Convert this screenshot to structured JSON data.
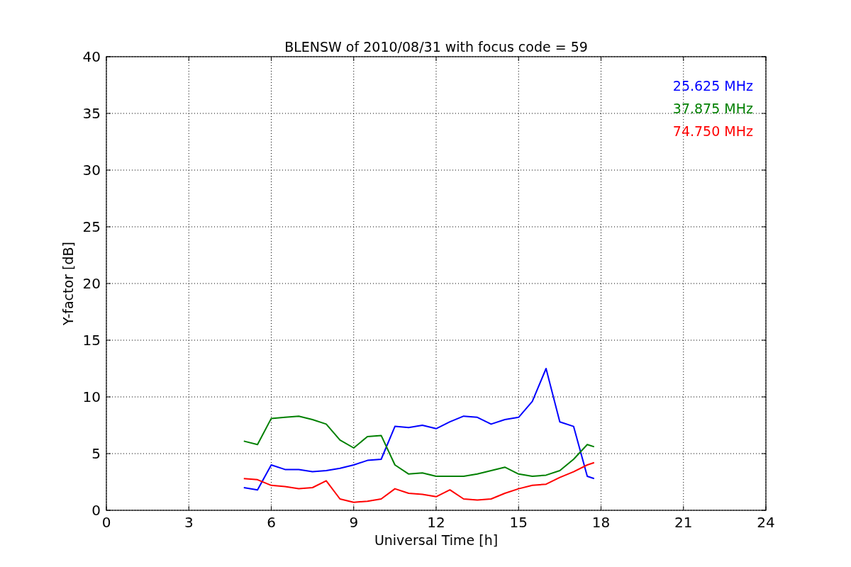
{
  "chart_data": {
    "type": "line",
    "title": "BLENSW of 2010/08/31 with focus code = 59",
    "xlabel": "Universal Time [h]",
    "ylabel": "Y-factor [dB]",
    "x": [
      5,
      5.5,
      6,
      6.5,
      7,
      7.5,
      8,
      8.5,
      9,
      9.5,
      10,
      10.5,
      11,
      11.5,
      12,
      12.5,
      13,
      13.5,
      14,
      14.5,
      15,
      15.5,
      16,
      16.5,
      17,
      17.5,
      17.75
    ],
    "series": [
      {
        "name": "25.625 MHz",
        "color": "#0000ff",
        "values": [
          2.0,
          1.8,
          4.0,
          3.6,
          3.6,
          3.4,
          3.5,
          3.7,
          4.0,
          4.4,
          4.5,
          7.4,
          7.3,
          7.5,
          7.2,
          7.8,
          8.3,
          8.2,
          7.6,
          8.0,
          8.2,
          9.6,
          12.5,
          7.8,
          7.4,
          3.0,
          2.8
        ]
      },
      {
        "name": "37.875 MHz",
        "color": "#008000",
        "values": [
          6.1,
          5.8,
          8.1,
          8.2,
          8.3,
          8.0,
          7.6,
          6.2,
          5.5,
          6.5,
          6.6,
          4.0,
          3.2,
          3.3,
          3.0,
          3.0,
          3.0,
          3.2,
          3.5,
          3.8,
          3.2,
          3.0,
          3.1,
          3.5,
          4.5,
          5.8,
          5.6
        ]
      },
      {
        "name": "74.750 MHz",
        "color": "#ff0000",
        "values": [
          2.8,
          2.7,
          2.2,
          2.1,
          1.9,
          2.0,
          2.6,
          1.0,
          0.7,
          0.8,
          1.0,
          1.9,
          1.5,
          1.4,
          1.2,
          1.8,
          1.0,
          0.9,
          1.0,
          1.5,
          1.9,
          2.2,
          2.3,
          2.9,
          3.4,
          4.0,
          4.2
        ]
      }
    ],
    "grid": true,
    "xlim": [
      0,
      24
    ],
    "ylim": [
      0,
      40
    ],
    "xticks": [
      0,
      3,
      6,
      9,
      12,
      15,
      18,
      21,
      24
    ],
    "yticks": [
      0,
      5,
      10,
      15,
      20,
      25,
      30,
      35,
      40
    ]
  }
}
